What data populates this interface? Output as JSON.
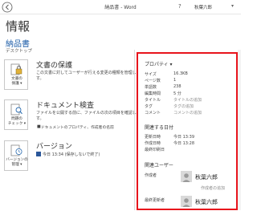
{
  "window": {
    "title": "納品書 - Word",
    "help": "?",
    "user": "秋葉六郎",
    "caret": "▾"
  },
  "page": {
    "heading": "情報",
    "doc_title": "納品書",
    "doc_path": "デスクトップ"
  },
  "sections": {
    "protect": {
      "button_label": [
        "文書の",
        "保護 ▾"
      ],
      "title": "文書の保護",
      "description": [
        "この文書に対してユーザーが行える変更の種類を管理しま",
        "す。"
      ]
    },
    "inspect": {
      "button_label": [
        "問題の",
        "チェック ▾"
      ],
      "title": "ドキュメント検査",
      "description": [
        "ファイルを公開する前に、ファイルの次の項目を確認しま",
        "す。"
      ],
      "bullet": "ドキュメントのプロパティ、作成者の名前"
    },
    "versions": {
      "button_label": [
        "バージョンの",
        "管理 ▾"
      ],
      "title": "バージョン",
      "entry": "今日 13:34 (保存しないで終了)"
    }
  },
  "properties": {
    "heading": "プロパティ ▾",
    "rows": [
      {
        "key": "サイズ",
        "value": "16.3KB",
        "placeholder": false
      },
      {
        "key": "ページ数",
        "value": "1",
        "placeholder": false
      },
      {
        "key": "単語数",
        "value": "238",
        "placeholder": false
      },
      {
        "key": "編集時間",
        "value": "5 分",
        "placeholder": false
      },
      {
        "key": "タイトル",
        "value": "タイトルの追加",
        "placeholder": true
      },
      {
        "key": "タグ",
        "value": "タグの追加",
        "placeholder": true
      },
      {
        "key": "コメント",
        "value": "コメントの追加",
        "placeholder": true
      }
    ],
    "dates_heading": "関連する日付",
    "dates": [
      {
        "key": "更新日時",
        "value": "今日 13:39"
      },
      {
        "key": "作成日時",
        "value": "今日 13:28"
      },
      {
        "key": "最終印刷日",
        "value": ""
      }
    ],
    "people_heading": "関連ユーザー",
    "author_label": "作成者",
    "author_name": "秋葉六郎",
    "add_author": "作成者の追加",
    "last_modified_label": "最終更新者",
    "last_modified_name": "秋葉六郎"
  },
  "colors": {
    "accent_blue": "#1f5ea8",
    "highlight_red": "#e8141c"
  },
  "icons": {
    "back": "back-arrow-icon",
    "help": "help-icon",
    "protect": "lock-document-icon",
    "inspect": "magnifier-check-icon",
    "versions": "document-history-icon",
    "avatar": "person-avatar-icon"
  }
}
